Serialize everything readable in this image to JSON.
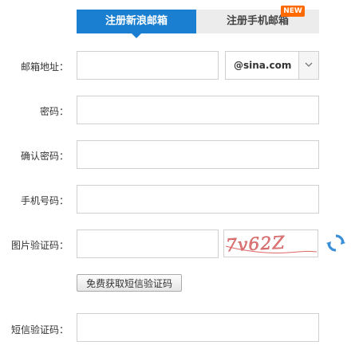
{
  "tabs": {
    "active_label": "注册新浪邮箱",
    "inactive_label": "注册手机邮箱",
    "new_badge": "NEW"
  },
  "form": {
    "email_label": "邮箱地址：",
    "email_value": "",
    "domain_value": "@sina.com",
    "password_label": "密码：",
    "confirm_password_label": "确认密码：",
    "phone_label": "手机号码：",
    "image_captcha_label": "图片验证码：",
    "captcha_text": "7v62Z",
    "sms_button_label": "免费获取短信验证码",
    "sms_code_label": "短信验证码："
  },
  "colors": {
    "accent": "#1a7fd0",
    "badge": "#ff6a00",
    "captcha_text": "#d9534f"
  }
}
